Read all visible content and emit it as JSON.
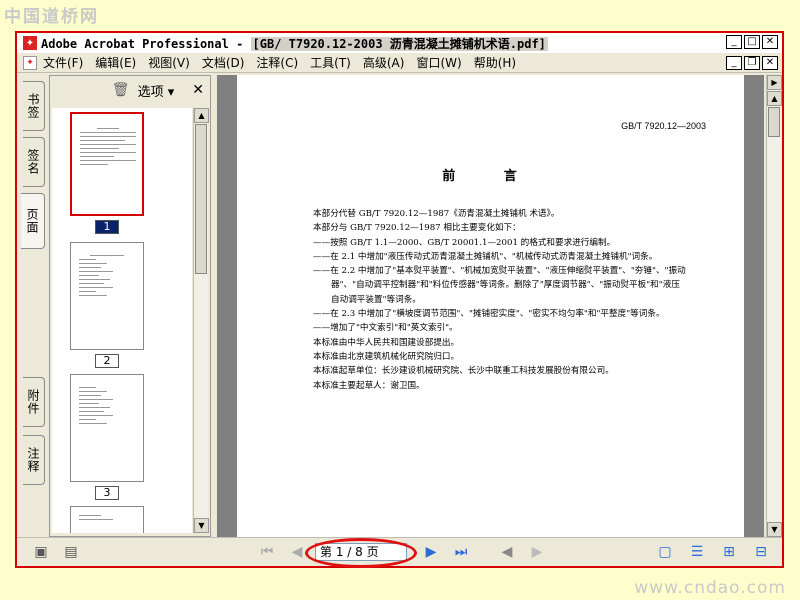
{
  "watermarks": {
    "top": "中国道桥网",
    "bottom": "www.cndao.com"
  },
  "titlebar": {
    "app_name": "Adobe Acrobat Professional - ",
    "file_name": "[GB/ T7920.12-2003 沥青混凝土摊铺机术语.pdf]"
  },
  "menubar": {
    "items": [
      "文件(F)",
      "编辑(E)",
      "视图(V)",
      "文档(D)",
      "注释(C)",
      "工具(T)",
      "高级(A)",
      "窗口(W)",
      "帮助(H)"
    ]
  },
  "left_tabs": {
    "bookmarks": "书签",
    "signatures": "签名",
    "pages": "页面",
    "attachments": "附件",
    "comments": "注释"
  },
  "thumb_panel": {
    "options_label": "选项",
    "pages": [
      "1",
      "2",
      "3"
    ]
  },
  "document": {
    "standard_number": "GB/T 7920.12—2003",
    "heading": "前 言",
    "lines": [
      "本部分代替 GB/T 7920.12—1987《沥青混凝土摊铺机  术语》。",
      "本部分与 GB/T 7920.12—1987 相比主要变化如下：",
      "——按照 GB/T 1.1—2000、GB/T 20001.1—2001 的格式和要求进行编制。",
      "——在 2.1 中增加\"液压传动式沥青混凝土摊铺机\"、\"机械传动式沥青混凝土摊铺机\"词条。",
      "——在 2.2 中增加了\"基本熨平装置\"、\"机械加宽熨平装置\"、\"液压伸缩熨平装置\"、\"夯锤\"、\"振动",
      "器\"、\"自动调平控制器\"和\"料位传感器\"等词条。删除了\"厚度调节器\"、\"振动熨平板\"和\"液压",
      "自动调平装置\"等词条。",
      "——在 2.3 中增加了\"横坡度调节范围\"、\"摊铺密实度\"、\"密实不均匀率\"和\"平整度\"等词条。",
      "——增加了\"中文索引\"和\"英文索引\"。",
      "本标准由中华人民共和国建设部提出。",
      "本标准由北京建筑机械化研究院归口。",
      "本标准起草单位：长沙建设机械研究院、长沙中联重工科技发展股份有限公司。",
      "本标准主要起草人：谢卫国。"
    ]
  },
  "bottombar": {
    "page_indicator": "第 1 / 8 页"
  }
}
